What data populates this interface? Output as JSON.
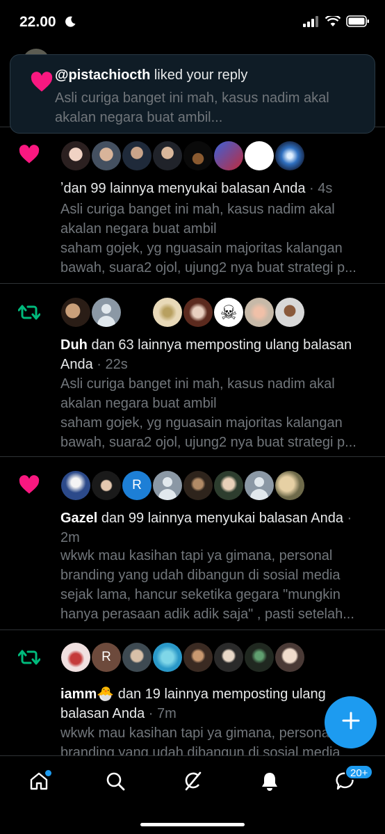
{
  "status": {
    "time": "22.00"
  },
  "toast": {
    "handle": "@pistachiocth",
    "action": " liked your reply",
    "text": "Asli curiga banget ini mah, kasus nadim akal akalan negara buat ambil..."
  },
  "notifications": [
    {
      "type": "like",
      "name": "",
      "headline_prefix": "ʼdan 99 lainnya menyukai balasan Anda",
      "time": "4s",
      "body_line1": "Asli curiga banget ini mah, kasus nadim akal",
      "body_line2": "akalan negara buat ambil",
      "body_line3": "saham gojek, yg nguasain majoritas kalangan",
      "body_line4": "bawah, suara2 ojol, ujung2 nya buat strategi p..."
    },
    {
      "type": "retweet",
      "name": "Duh",
      "headline_prefix": " dan 63 lainnya memposting ulang balasan Anda",
      "time": "22s",
      "body_line1": "Asli curiga banget ini mah, kasus nadim akal",
      "body_line2": "akalan negara buat ambil",
      "body_line3": "saham gojek, yg nguasain majoritas kalangan",
      "body_line4": "bawah, suara2 ojol, ujung2 nya buat strategi p..."
    },
    {
      "type": "like",
      "name": "Gazel",
      "headline_prefix": " dan 99 lainnya menyukai balasan Anda",
      "time": "2m",
      "body_line1": "wkwk mau kasihan tapi ya gimana, personal",
      "body_line2": "branding yang udah dibangun di sosial media",
      "body_line3": "sejak lama, hancur seketika gegara \"mungkin",
      "body_line4": "hanya perasaan adik adik saja\" , pasti setelah..."
    },
    {
      "type": "retweet",
      "name": "iamm🐣",
      "headline_prefix": " dan 19 lainnya memposting ulang balasan Anda",
      "time": "7m",
      "body_line1": "wkwk mau kasihan tapi ya gimana, personal",
      "body_line2": "branding yang udah dibangun di sosial media"
    }
  ],
  "avatar_letters": {
    "r1": "R",
    "r2": "R"
  },
  "avatar_emoji": {
    "heart_eyes": "😍",
    "skull": "☠"
  },
  "tabbar": {
    "messages_badge": "20+"
  },
  "colors": {
    "like": "#f91880",
    "retweet": "#00ba7c",
    "accent": "#1d9bf0"
  },
  "icons": [
    "home-icon",
    "search-icon",
    "grok-icon",
    "bell-icon",
    "messages-icon",
    "compose-plus-icon",
    "heart-icon",
    "retweet-icon"
  ]
}
